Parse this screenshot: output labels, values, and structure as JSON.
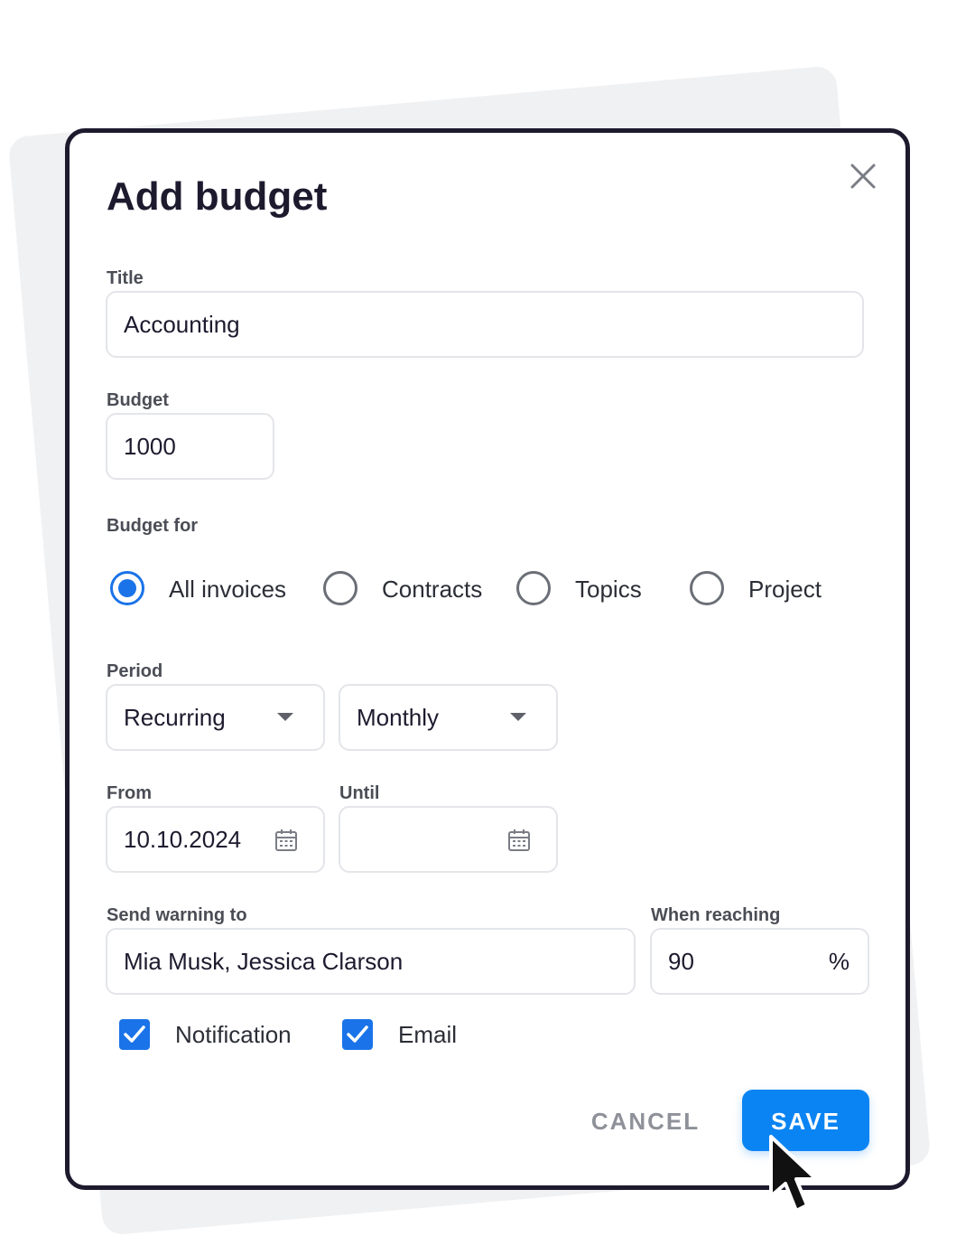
{
  "dialog": {
    "title": "Add budget",
    "close_icon": "close-icon"
  },
  "fields": {
    "title_label": "Title",
    "title_value": "Accounting",
    "budget_label": "Budget",
    "budget_value": "1000",
    "budget_for_label": "Budget for",
    "budget_for_options": [
      {
        "label": "All invoices",
        "selected": true
      },
      {
        "label": "Contracts",
        "selected": false
      },
      {
        "label": "Topics",
        "selected": false
      },
      {
        "label": "Project",
        "selected": false
      }
    ],
    "period_label": "Period",
    "period_type": "Recurring",
    "period_frequency": "Monthly",
    "from_label": "From",
    "from_value": "10.10.2024",
    "until_label": "Until",
    "until_value": "",
    "warning_label": "Send warning to",
    "warning_value": "Mia Musk, Jessica Clarson",
    "threshold_label": "When reaching",
    "threshold_value": "90",
    "threshold_unit": "%",
    "notify_options": [
      {
        "label": "Notification",
        "checked": true
      },
      {
        "label": "Email",
        "checked": true
      }
    ]
  },
  "actions": {
    "cancel_label": "CANCEL",
    "save_label": "SAVE"
  },
  "colors": {
    "accent": "#1a73e8",
    "save_button": "#0b84f3",
    "border": "#1e1a2e"
  },
  "icons": [
    "close-icon",
    "chevron-down-icon",
    "calendar-icon",
    "checkmark-icon",
    "mouse-pointer-icon"
  ]
}
